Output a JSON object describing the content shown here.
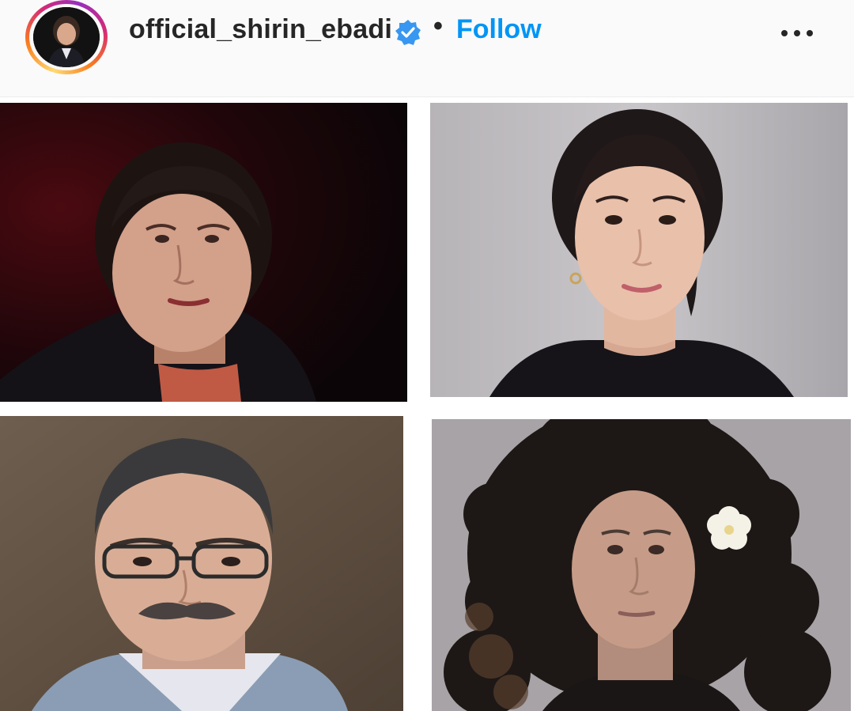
{
  "header": {
    "username": "official_shirin_ebadi",
    "separator": "•",
    "follow_label": "Follow",
    "verified_icon": "verified-badge-icon",
    "more_icon": "more-options-icon"
  },
  "colors": {
    "follow_blue": "#0095f6",
    "verified_blue": "#3897f0",
    "text_dark": "#262626"
  },
  "post": {
    "photos": [
      {
        "name": "portrait-photo-1"
      },
      {
        "name": "portrait-photo-2"
      },
      {
        "name": "portrait-photo-3"
      },
      {
        "name": "portrait-photo-4"
      }
    ]
  }
}
